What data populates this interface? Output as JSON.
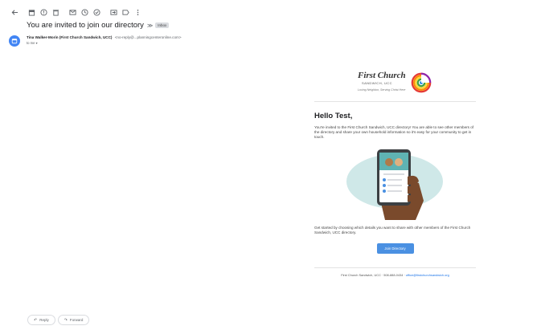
{
  "email": {
    "subject": "You are invited to join our directory",
    "label": "Inbox",
    "sender_name": "Tina Walker-Morin (First Church Sandwich, UCC)",
    "sender_email": "<no-reply@...planningcenteronline.com>",
    "to_line": "to me"
  },
  "body": {
    "logo_title": "First Church",
    "logo_sub": "SANDWICH, UCC",
    "logo_tagline": "Loving Neighbor, Serving Christ Here",
    "greeting": "Hello Test,",
    "intro": "You're invited to the First Church Sandwich, UCC directory! You are able to see other members of the directory and share your own household information so it's easy for your community to get in touch.",
    "cta_text": "Get started by choosing which details you want to share with other members of the First Church Sandwich, UCC directory.",
    "join_button": "Join Directory",
    "footer_org": "First Church Sandwich, UCC",
    "footer_phone": "508-888-0434",
    "footer_email": "office@firstchurchsandwich.org"
  },
  "actions": {
    "reply": "Reply",
    "forward": "Forward"
  },
  "icons": [
    "back-arrow-icon",
    "archive-icon",
    "report-spam-icon",
    "delete-icon",
    "mark-unread-icon",
    "snooze-icon",
    "add-task-icon",
    "move-to-icon",
    "label-icon",
    "more-icon"
  ],
  "colors": {
    "accent": "#4285f4",
    "button": "#4a90e2",
    "link": "#1a73e8"
  }
}
